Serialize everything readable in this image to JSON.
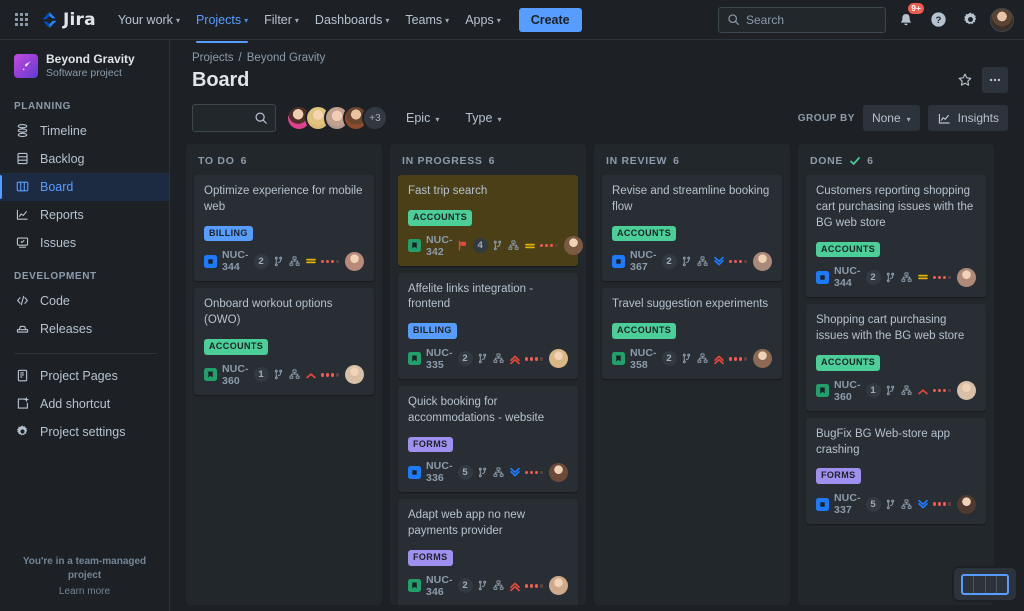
{
  "topnav": {
    "app_switcher": "app-switcher",
    "brand": "Jira",
    "items": [
      {
        "label": "Your work",
        "caret": true,
        "active": false
      },
      {
        "label": "Projects",
        "caret": true,
        "active": true
      },
      {
        "label": "Filter",
        "caret": true,
        "active": false
      },
      {
        "label": "Dashboards",
        "caret": true,
        "active": false
      },
      {
        "label": "Teams",
        "caret": true,
        "active": false
      },
      {
        "label": "Apps",
        "caret": true,
        "active": false
      }
    ],
    "create_label": "Create",
    "search_placeholder": "Search",
    "notification_badge": "9+",
    "accent": "#579dff"
  },
  "sidebar": {
    "project_name": "Beyond Gravity",
    "project_type": "Software project",
    "section_planning": "PLANNING",
    "section_development": "DEVELOPMENT",
    "planning_items": [
      {
        "label": "Timeline",
        "icon": "timeline-icon",
        "selected": false
      },
      {
        "label": "Backlog",
        "icon": "backlog-icon",
        "selected": false
      },
      {
        "label": "Board",
        "icon": "board-icon",
        "selected": true
      },
      {
        "label": "Reports",
        "icon": "reports-icon",
        "selected": false
      },
      {
        "label": "Issues",
        "icon": "issues-icon",
        "selected": false
      }
    ],
    "development_items": [
      {
        "label": "Code",
        "icon": "code-icon",
        "selected": false
      },
      {
        "label": "Releases",
        "icon": "releases-icon",
        "selected": false
      }
    ],
    "other_items": [
      {
        "label": "Project Pages",
        "icon": "pages-icon",
        "selected": false
      },
      {
        "label": "Add shortcut",
        "icon": "add-shortcut-icon",
        "selected": false
      },
      {
        "label": "Project settings",
        "icon": "settings-icon",
        "selected": false
      }
    ],
    "footer_line1": "You're in a team-managed project",
    "footer_line2": "Learn more"
  },
  "header": {
    "breadcrumb_projects": "Projects",
    "breadcrumb_sep": "/",
    "breadcrumb_current": "Beyond Gravity",
    "title": "Board",
    "star_icon": "star-icon",
    "more_icon": "more-actions-icon"
  },
  "toolbar": {
    "filter_placeholder": "",
    "avatar_more": "+3",
    "epic_label": "Epic",
    "type_label": "Type",
    "group_by_label": "GROUP BY",
    "group_by_value": "None",
    "insights_label": "Insights"
  },
  "board": {
    "layout_toggle": "board-layout-toggle",
    "columns": [
      {
        "name": "TO DO",
        "count": "6",
        "done": false,
        "cards": [
          {
            "title": "Optimize experience for mobile web",
            "epic": "BILLING",
            "epic_color": "#579dff",
            "epic_text": "#1d2125",
            "key": "NUC-344",
            "type": "task",
            "type_color": "#1d7afc",
            "flag": false,
            "count": "2",
            "priority": "medium",
            "priority_color": "#e2b203",
            "avatar": "#b98a7a"
          },
          {
            "title": "Onboard workout options (OWO)",
            "epic": "ACCOUNTS",
            "epic_color": "#4bce97",
            "epic_text": "#1d2125",
            "key": "NUC-360",
            "type": "story",
            "type_color": "#22a06b",
            "flag": false,
            "count": "1",
            "priority": "high",
            "priority_color": "#e2483d",
            "avatar": "#d8bfa8"
          }
        ]
      },
      {
        "name": "IN PROGRESS",
        "count": "6",
        "done": false,
        "cards": [
          {
            "title": "Fast trip search",
            "epic": "ACCOUNTS",
            "epic_color": "#4bce97",
            "epic_text": "#1d2125",
            "key": "NUC-342",
            "type": "story",
            "type_color": "#22a06b",
            "flag": true,
            "count": "4",
            "priority": "medium",
            "priority_color": "#e2b203",
            "avatar": "#7a5a42",
            "highlight": true
          },
          {
            "title": "Affelite links integration - frontend",
            "epic": "BILLING",
            "epic_color": "#579dff",
            "epic_text": "#1d2125",
            "key": "NUC-335",
            "type": "story",
            "type_color": "#22a06b",
            "flag": false,
            "count": "2",
            "priority": "highest",
            "priority_color": "#e2483d",
            "avatar": "#d9b886"
          },
          {
            "title": "Quick booking for accommodations - website",
            "epic": "FORMS",
            "epic_color": "#9f8fef",
            "epic_text": "#1d2125",
            "key": "NUC-336",
            "type": "task",
            "type_color": "#1d7afc",
            "flag": false,
            "count": "5",
            "priority": "lowest",
            "priority_color": "#1d7afc",
            "avatar": "#6b4a3a"
          },
          {
            "title": "Adapt web app no new payments provider",
            "epic": "FORMS",
            "epic_color": "#9f8fef",
            "epic_text": "#1d2125",
            "key": "NUC-346",
            "type": "story",
            "type_color": "#22a06b",
            "flag": false,
            "count": "2",
            "priority": "highest",
            "priority_color": "#e2483d",
            "avatar": "#cfa98c"
          }
        ]
      },
      {
        "name": "IN REVIEW",
        "count": "6",
        "done": false,
        "cards": [
          {
            "title": "Revise and streamline booking flow",
            "epic": "ACCOUNTS",
            "epic_color": "#4bce97",
            "epic_text": "#1d2125",
            "key": "NUC-367",
            "type": "task",
            "type_color": "#1d7afc",
            "flag": false,
            "count": "2",
            "priority": "lowest",
            "priority_color": "#1d7afc",
            "avatar": "#a8897a"
          },
          {
            "title": "Travel suggestion experiments",
            "epic": "ACCOUNTS",
            "epic_color": "#4bce97",
            "epic_text": "#1d2125",
            "key": "NUC-358",
            "type": "story",
            "type_color": "#22a06b",
            "flag": false,
            "count": "2",
            "priority": "highest",
            "priority_color": "#e2483d",
            "avatar": "#8d6a55"
          }
        ]
      },
      {
        "name": "DONE",
        "count": "6",
        "done": true,
        "cards": [
          {
            "title": "Customers reporting shopping cart purchasing issues with the BG web store",
            "epic": "ACCOUNTS",
            "epic_color": "#4bce97",
            "epic_text": "#1d2125",
            "key": "NUC-344",
            "type": "task",
            "type_color": "#1d7afc",
            "flag": false,
            "count": "2",
            "priority": "medium",
            "priority_color": "#e2b203",
            "avatar": "#b08a78"
          },
          {
            "title": "Shopping cart purchasing issues with the BG web store",
            "epic": "ACCOUNTS",
            "epic_color": "#4bce97",
            "epic_text": "#1d2125",
            "key": "NUC-360",
            "type": "story",
            "type_color": "#22a06b",
            "flag": false,
            "count": "1",
            "priority": "high",
            "priority_color": "#e2483d",
            "avatar": "#d8bfa8"
          },
          {
            "title": "BugFix BG Web-store app crashing",
            "epic": "FORMS",
            "epic_color": "#9f8fef",
            "epic_text": "#1d2125",
            "key": "NUC-337",
            "type": "task",
            "type_color": "#1d7afc",
            "flag": false,
            "count": "5",
            "priority": "lowest",
            "priority_color": "#1d7afc",
            "avatar": "#4e3a30"
          }
        ]
      }
    ]
  }
}
